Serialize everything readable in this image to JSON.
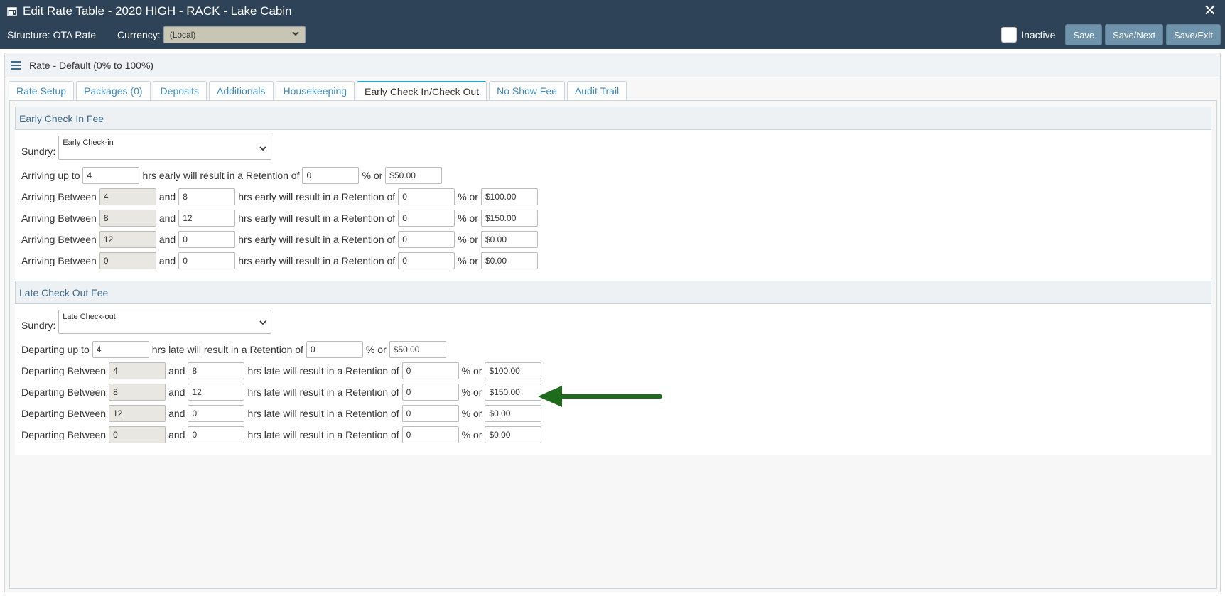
{
  "window": {
    "title": "Edit Rate Table - 2020 HIGH - RACK - Lake Cabin",
    "close_label": "✕"
  },
  "toolbar": {
    "structure_label": "Structure: OTA Rate",
    "currency_label": "Currency:",
    "currency_value": "(Local)",
    "inactive_label": "Inactive",
    "save_label": "Save",
    "save_next_label": "Save/Next",
    "save_exit_label": "Save/Exit"
  },
  "panel": {
    "title": "Rate - Default (0% to 100%)"
  },
  "tabs": [
    {
      "label": "Rate Setup"
    },
    {
      "label": "Packages (0)"
    },
    {
      "label": "Deposits"
    },
    {
      "label": "Additionals"
    },
    {
      "label": "Housekeeping"
    },
    {
      "label": "Early Check In/Check Out"
    },
    {
      "label": "No Show Fee"
    },
    {
      "label": "Audit Trail"
    }
  ],
  "early": {
    "header": "Early Check In Fee",
    "sundry_label": "Sundry:",
    "sundry_value": "Early Check-in",
    "first": {
      "prefix": "Arriving up to",
      "hours": "4",
      "text": "hrs early will result in a Retention of",
      "pct": "0",
      "or": "% or",
      "amount": "$50.00"
    },
    "rows": [
      {
        "prefix": "Arriving Between",
        "from": "4",
        "and": "and",
        "to": "8",
        "text": "hrs early will result in a Retention of",
        "pct": "0",
        "or": "% or",
        "amount": "$100.00"
      },
      {
        "prefix": "Arriving Between",
        "from": "8",
        "and": "and",
        "to": "12",
        "text": "hrs early will result in a Retention of",
        "pct": "0",
        "or": "% or",
        "amount": "$150.00"
      },
      {
        "prefix": "Arriving Between",
        "from": "12",
        "and": "and",
        "to": "0",
        "text": "hrs early will result in a Retention of",
        "pct": "0",
        "or": "% or",
        "amount": "$0.00"
      },
      {
        "prefix": "Arriving Between",
        "from": "0",
        "and": "and",
        "to": "0",
        "text": "hrs early will result in a Retention of",
        "pct": "0",
        "or": "% or",
        "amount": "$0.00"
      }
    ]
  },
  "late": {
    "header": "Late Check Out Fee",
    "sundry_label": "Sundry:",
    "sundry_value": "Late Check-out",
    "first": {
      "prefix": "Departing up to",
      "hours": "4",
      "text": "hrs late will result in a Retention of",
      "pct": "0",
      "or": "% or",
      "amount": "$50.00"
    },
    "rows": [
      {
        "prefix": "Departing Between",
        "from": "4",
        "and": "and",
        "to": "8",
        "text": "hrs late will result in a Retention of",
        "pct": "0",
        "or": "% or",
        "amount": "$100.00"
      },
      {
        "prefix": "Departing Between",
        "from": "8",
        "and": "and",
        "to": "12",
        "text": "hrs late will result in a Retention of",
        "pct": "0",
        "or": "% or",
        "amount": "$150.00"
      },
      {
        "prefix": "Departing Between",
        "from": "12",
        "and": "and",
        "to": "0",
        "text": "hrs late will result in a Retention of",
        "pct": "0",
        "or": "% or",
        "amount": "$0.00"
      },
      {
        "prefix": "Departing Between",
        "from": "0",
        "and": "and",
        "to": "0",
        "text": "hrs late will result in a Retention of",
        "pct": "0",
        "or": "% or",
        "amount": "$0.00"
      }
    ]
  },
  "colors": {
    "header_bg": "#2e4358",
    "button_bg": "#6e93aa",
    "active_tab_accent": "#2ba3c8",
    "annotation_arrow": "#1e6b1e"
  },
  "icons": {
    "calendar": "calendar-icon",
    "menu": "hamburger-menu-icon",
    "close": "close-icon",
    "dropdown": "chevron-down-icon",
    "annotation": "arrow-left-icon"
  }
}
